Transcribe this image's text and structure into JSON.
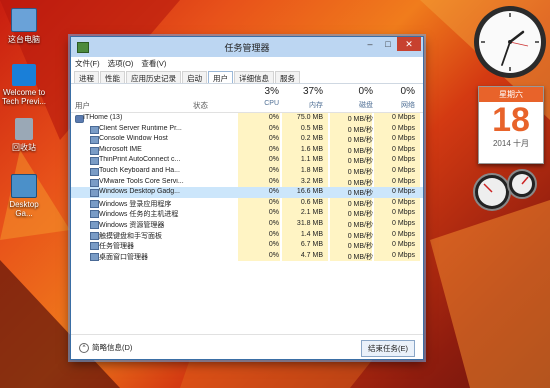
{
  "desktop": {
    "icons": [
      {
        "label": "这台电脑"
      },
      {
        "label": "Welcome to Tech Previ..."
      },
      {
        "label": "回收站"
      },
      {
        "label": "Desktop Ga..."
      }
    ]
  },
  "calendar": {
    "weekday": "星期六",
    "day": "18",
    "month": "2014 十月"
  },
  "window": {
    "title": "任务管理器",
    "menu": [
      "文件(F)",
      "选项(O)",
      "查看(V)"
    ],
    "tabs": [
      "进程",
      "性能",
      "应用历史记录",
      "启动",
      "用户",
      "详细信息",
      "服务"
    ],
    "active_tab": "用户",
    "columns": {
      "user": "用户",
      "status": "状态",
      "cpu_pct": "3%",
      "cpu": "CPU",
      "mem_pct": "37%",
      "mem": "内存",
      "disk_pct": "0%",
      "disk": "磁盘",
      "net_pct": "0%",
      "net": "网络"
    },
    "rows": [
      {
        "name": "ITHome (13)",
        "cpu": "0%",
        "mem": "75.0 MB",
        "disk": "0 MB/秒",
        "net": "0 Mbps"
      },
      {
        "name": "Client Server Runtime Pr...",
        "cpu": "0%",
        "mem": "0.5 MB",
        "disk": "0 MB/秒",
        "net": "0 Mbps"
      },
      {
        "name": "Console Window Host",
        "cpu": "0%",
        "mem": "0.2 MB",
        "disk": "0 MB/秒",
        "net": "0 Mbps"
      },
      {
        "name": "Microsoft IME",
        "cpu": "0%",
        "mem": "1.6 MB",
        "disk": "0 MB/秒",
        "net": "0 Mbps"
      },
      {
        "name": "ThinPrint AutoConnect c...",
        "cpu": "0%",
        "mem": "1.1 MB",
        "disk": "0 MB/秒",
        "net": "0 Mbps"
      },
      {
        "name": "Touch Keyboard and Ha...",
        "cpu": "0%",
        "mem": "1.8 MB",
        "disk": "0 MB/秒",
        "net": "0 Mbps"
      },
      {
        "name": "VMware Tools Core Servi...",
        "cpu": "0%",
        "mem": "3.2 MB",
        "disk": "0 MB/秒",
        "net": "0 Mbps"
      },
      {
        "name": "Windows Desktop Gadg...",
        "cpu": "0%",
        "mem": "16.6 MB",
        "disk": "0 MB/秒",
        "net": "0 Mbps"
      },
      {
        "name": "Windows 登录应用程序",
        "cpu": "0%",
        "mem": "0.6 MB",
        "disk": "0 MB/秒",
        "net": "0 Mbps"
      },
      {
        "name": "Windows 任务的主机进程",
        "cpu": "0%",
        "mem": "2.1 MB",
        "disk": "0 MB/秒",
        "net": "0 Mbps"
      },
      {
        "name": "Windows 资源管理器",
        "cpu": "0%",
        "mem": "31.8 MB",
        "disk": "0 MB/秒",
        "net": "0 Mbps"
      },
      {
        "name": "触摸键盘和手写面板",
        "cpu": "0%",
        "mem": "1.4 MB",
        "disk": "0 MB/秒",
        "net": "0 Mbps"
      },
      {
        "name": "任务管理器",
        "cpu": "0%",
        "mem": "6.7 MB",
        "disk": "0 MB/秒",
        "net": "0 Mbps"
      },
      {
        "name": "桌面窗口管理器",
        "cpu": "0%",
        "mem": "4.7 MB",
        "disk": "0 MB/秒",
        "net": "0 Mbps"
      }
    ],
    "fewer_details": "简略信息(D)",
    "end_task": "结束任务(E)"
  },
  "colors": {
    "accent": "#e8632a",
    "highlight": "#fff4c4",
    "selected": "#cce6fb"
  }
}
